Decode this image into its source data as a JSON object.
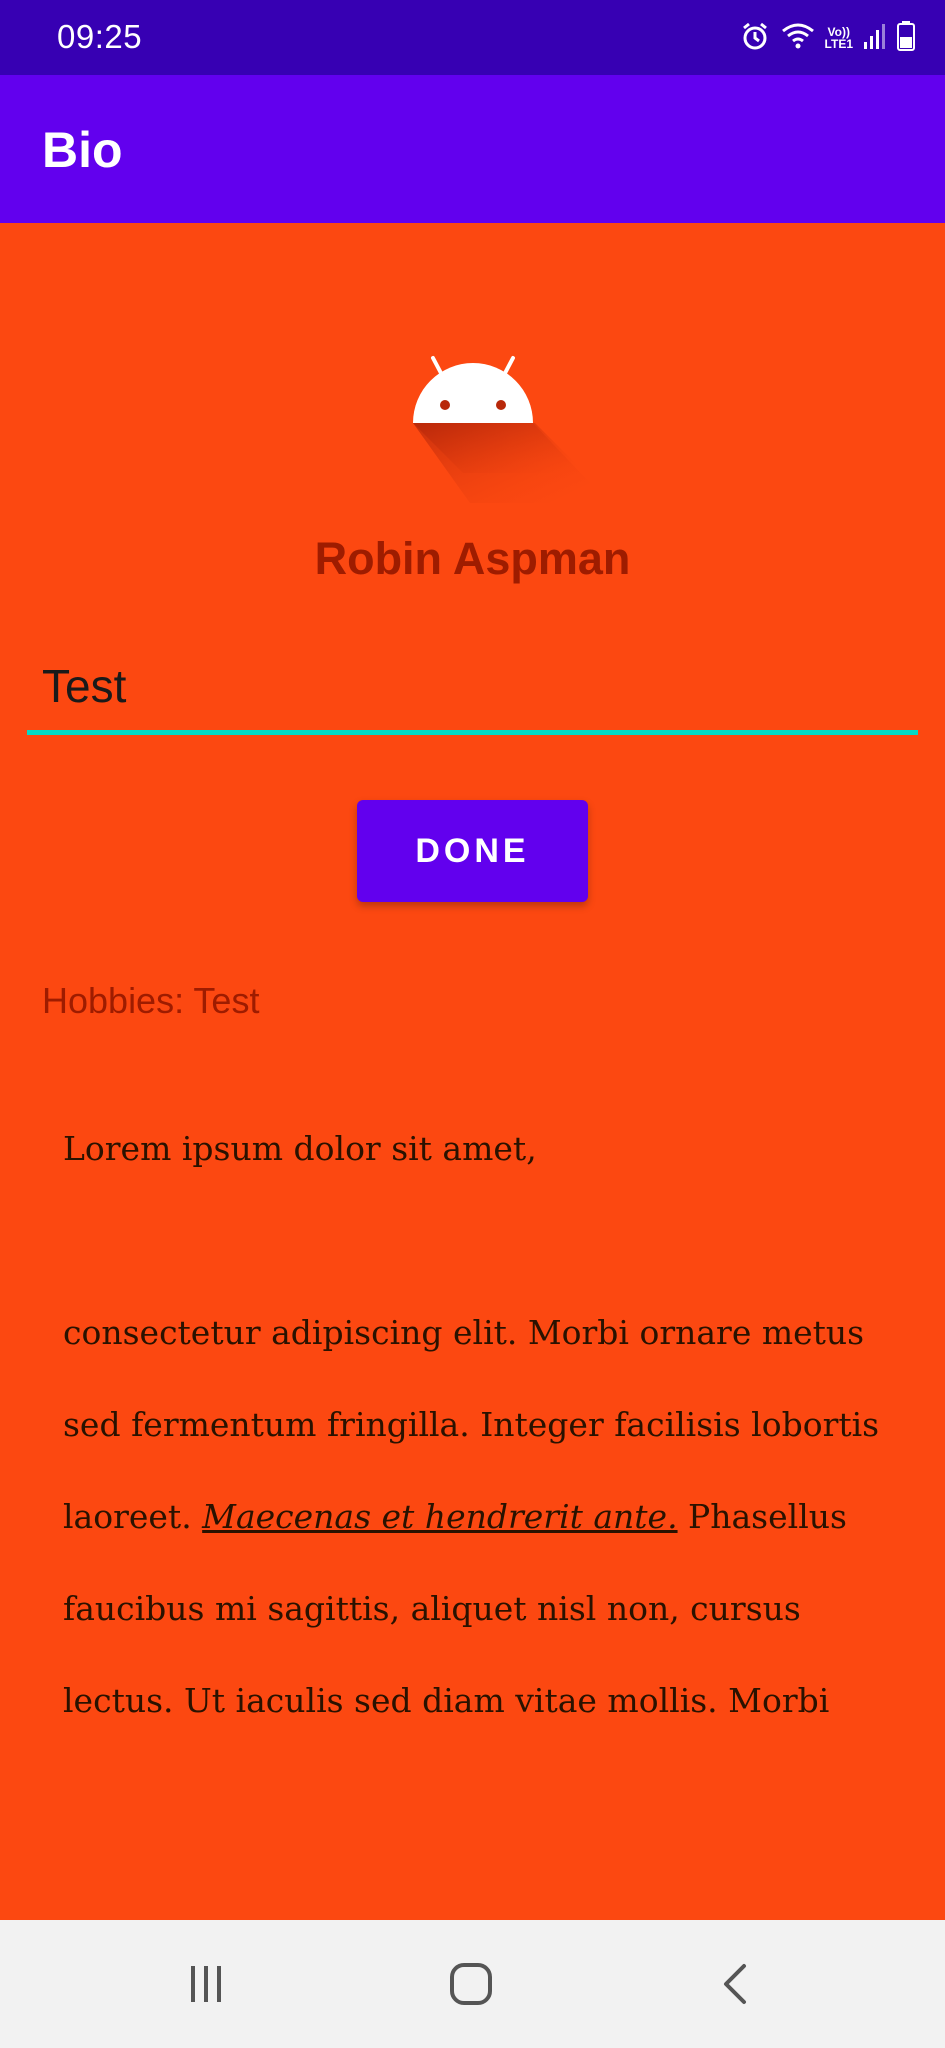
{
  "status_bar": {
    "time": "09:25",
    "icons": [
      "alarm-icon",
      "wifi-icon",
      "volte-lte-icon",
      "signal-icon",
      "battery-icon"
    ],
    "lte_label_top": "Vo))",
    "lte_label_bottom": "LTE1"
  },
  "app_bar": {
    "title": "Bio"
  },
  "profile": {
    "name": "Robin Aspman"
  },
  "hobby_input": {
    "value": "Test"
  },
  "done_button": {
    "label": "DONE"
  },
  "hobbies_text": "Hobbies: Test",
  "bio": {
    "first_line": "Lorem ipsum dolor sit amet,",
    "part1": "consectetur adipiscing elit. Morbi ornare metus sed fermentum fringilla. Integer facilisis lobortis laoreet. ",
    "emphasis": "Maecenas et hendrerit ante.",
    "part2": " Phasellus faucibus mi sagittis, aliquet nisl non, cursus lectus. Ut iaculis sed diam vitae mollis. Morbi dignissim tortor nec dolor hendrerit pulvinar. Quisque ac mi ex. Fusce"
  },
  "nav_bar": {
    "icons": [
      "recent-apps-icon",
      "home-icon",
      "back-icon"
    ]
  },
  "colors": {
    "status_bar": "#3700B3",
    "app_bar": "#6200EE",
    "background": "#FC4811",
    "accent": "#03DAC5",
    "name_text": "#9E1C00"
  }
}
